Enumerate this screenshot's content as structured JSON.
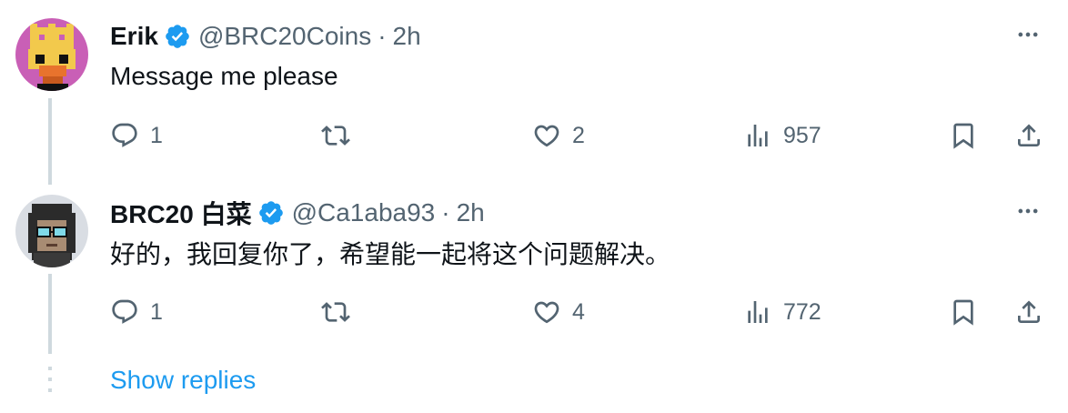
{
  "tweets": [
    {
      "name": "Erik",
      "handle": "@BRC20Coins",
      "separator": "·",
      "time": "2h",
      "text": "Message me please",
      "stats": {
        "replies": "1",
        "likes": "2",
        "views": "957"
      },
      "avatar_bg": "#c95fb6"
    },
    {
      "name": "BRC20 白菜",
      "handle": "@Ca1aba93",
      "separator": "·",
      "time": "2h",
      "text": "好的，我回复你了，希望能一起将这个问题解决。",
      "stats": {
        "replies": "1",
        "likes": "4",
        "views": "772"
      },
      "avatar_bg": "#d9dde3"
    }
  ],
  "show_replies": "Show replies",
  "colors": {
    "verified": "#1d9bf0",
    "secondary_text": "#536471",
    "link": "#1d9bf0",
    "thread_line": "#cfd9de"
  },
  "icons": [
    "verified-badge-icon",
    "more-icon",
    "reply-icon",
    "retweet-icon",
    "like-icon",
    "views-icon",
    "bookmark-icon",
    "share-icon"
  ]
}
